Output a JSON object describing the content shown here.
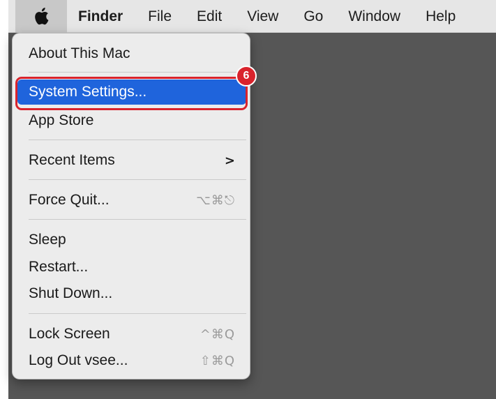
{
  "menubar": {
    "apple_icon": "apple-logo",
    "items": [
      "Finder",
      "File",
      "Edit",
      "View",
      "Go",
      "Window",
      "Help"
    ]
  },
  "apple_menu": {
    "about": "About This Mac",
    "system_settings": "System Settings...",
    "app_store": "App Store",
    "recent_items": "Recent Items",
    "recent_items_chevron": ">",
    "force_quit": "Force Quit...",
    "force_quit_shortcut": "⌥⌘⎋",
    "sleep": "Sleep",
    "restart": "Restart...",
    "shut_down": "Shut Down...",
    "lock_screen": "Lock Screen",
    "lock_screen_shortcut": "^⌘Q",
    "log_out": "Log Out vsee...",
    "log_out_shortcut": "⇧⌘Q"
  },
  "annotation": {
    "step_number": "6",
    "color": "#d9232c"
  },
  "colors": {
    "highlight": "#1f64dc",
    "desktop": "#565656",
    "menubar": "#e6e6e6"
  }
}
